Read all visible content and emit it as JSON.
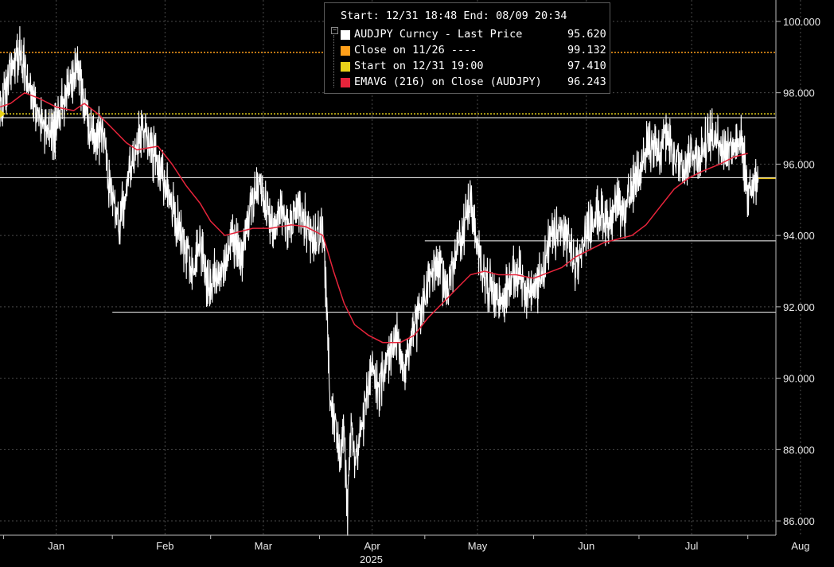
{
  "chart_data": {
    "type": "line",
    "series": [
      {
        "name": "AUDJPY Curncy - Last Price",
        "color": "#ffffff",
        "points": [
          [
            "2024-12-31",
            97.41
          ],
          [
            "2025-01-03",
            98.6
          ],
          [
            "2025-01-06",
            99.1
          ],
          [
            "2025-01-08",
            98.2
          ],
          [
            "2025-01-10",
            97.6
          ],
          [
            "2025-01-13",
            97.1
          ],
          [
            "2025-01-15",
            96.7
          ],
          [
            "2025-01-17",
            97.5
          ],
          [
            "2025-01-20",
            98.3
          ],
          [
            "2025-01-22",
            98.7
          ],
          [
            "2025-01-24",
            97.6
          ],
          [
            "2025-01-27",
            96.6
          ],
          [
            "2025-01-29",
            97.0
          ],
          [
            "2025-01-31",
            95.6
          ],
          [
            "2025-02-03",
            94.4
          ],
          [
            "2025-02-05",
            95.3
          ],
          [
            "2025-02-07",
            96.2
          ],
          [
            "2025-02-10",
            97.1
          ],
          [
            "2025-02-12",
            96.5
          ],
          [
            "2025-02-14",
            95.9
          ],
          [
            "2025-02-17",
            95.2
          ],
          [
            "2025-02-19",
            94.5
          ],
          [
            "2025-02-21",
            93.9
          ],
          [
            "2025-02-24",
            93.0
          ],
          [
            "2025-02-26",
            93.9
          ],
          [
            "2025-02-28",
            92.5
          ],
          [
            "2025-03-03",
            92.9
          ],
          [
            "2025-03-05",
            93.2
          ],
          [
            "2025-03-07",
            94.0
          ],
          [
            "2025-03-10",
            93.4
          ],
          [
            "2025-03-12",
            94.5
          ],
          [
            "2025-03-14",
            95.5
          ],
          [
            "2025-03-17",
            94.9
          ],
          [
            "2025-03-19",
            94.1
          ],
          [
            "2025-03-21",
            94.7
          ],
          [
            "2025-03-24",
            94.3
          ],
          [
            "2025-03-26",
            95.0
          ],
          [
            "2025-03-28",
            94.4
          ],
          [
            "2025-03-31",
            93.7
          ],
          [
            "2025-04-02",
            94.4
          ],
          [
            "2025-04-03",
            92.2
          ],
          [
            "2025-04-04",
            89.6
          ],
          [
            "2025-04-07",
            87.7
          ],
          [
            "2025-04-08",
            88.6
          ],
          [
            "2025-04-09",
            86.2
          ],
          [
            "2025-04-10",
            88.9
          ],
          [
            "2025-04-11",
            87.4
          ],
          [
            "2025-04-14",
            89.2
          ],
          [
            "2025-04-16",
            90.4
          ],
          [
            "2025-04-18",
            89.8
          ],
          [
            "2025-04-21",
            90.6
          ],
          [
            "2025-04-23",
            91.1
          ],
          [
            "2025-04-25",
            90.3
          ],
          [
            "2025-04-28",
            91.4
          ],
          [
            "2025-04-30",
            91.9
          ],
          [
            "2025-05-02",
            92.8
          ],
          [
            "2025-05-05",
            93.3
          ],
          [
            "2025-05-07",
            92.5
          ],
          [
            "2025-05-09",
            93.1
          ],
          [
            "2025-05-12",
            94.2
          ],
          [
            "2025-05-14",
            95.1
          ],
          [
            "2025-05-16",
            93.5
          ],
          [
            "2025-05-19",
            92.6
          ],
          [
            "2025-05-21",
            92.4
          ],
          [
            "2025-05-23",
            92.1
          ],
          [
            "2025-05-26",
            92.8
          ],
          [
            "2025-05-28",
            93.0
          ],
          [
            "2025-05-30",
            92.3
          ],
          [
            "2025-06-02",
            92.6
          ],
          [
            "2025-06-04",
            93.2
          ],
          [
            "2025-06-06",
            93.9
          ],
          [
            "2025-06-09",
            94.2
          ],
          [
            "2025-06-11",
            93.8
          ],
          [
            "2025-06-13",
            93.1
          ],
          [
            "2025-06-16",
            94.1
          ],
          [
            "2025-06-18",
            94.4
          ],
          [
            "2025-06-20",
            94.7
          ],
          [
            "2025-06-23",
            94.3
          ],
          [
            "2025-06-25",
            94.9
          ],
          [
            "2025-06-27",
            94.6
          ],
          [
            "2025-06-30",
            95.6
          ],
          [
            "2025-07-02",
            96.1
          ],
          [
            "2025-07-04",
            96.6
          ],
          [
            "2025-07-07",
            96.2
          ],
          [
            "2025-07-09",
            96.9
          ],
          [
            "2025-07-11",
            96.3
          ],
          [
            "2025-07-14",
            96.0
          ],
          [
            "2025-07-16",
            96.4
          ],
          [
            "2025-07-18",
            96.2
          ],
          [
            "2025-07-21",
            96.7
          ],
          [
            "2025-07-23",
            96.9
          ],
          [
            "2025-07-25",
            96.4
          ],
          [
            "2025-07-28",
            96.6
          ],
          [
            "2025-07-30",
            96.8
          ],
          [
            "2025-07-31",
            96.0
          ],
          [
            "2025-08-01",
            95.3
          ],
          [
            "2025-08-04",
            95.6
          ]
        ]
      },
      {
        "name": "EMAVG (216)  on Close (AUDJPY)",
        "color": "#e8243b",
        "points": [
          [
            "2024-12-31",
            97.6
          ],
          [
            "2025-01-03",
            97.7
          ],
          [
            "2025-01-07",
            98.0
          ],
          [
            "2025-01-11",
            97.85
          ],
          [
            "2025-01-16",
            97.6
          ],
          [
            "2025-01-21",
            97.5
          ],
          [
            "2025-01-24",
            97.7
          ],
          [
            "2025-01-28",
            97.4
          ],
          [
            "2025-02-01",
            97.0
          ],
          [
            "2025-02-05",
            96.6
          ],
          [
            "2025-02-08",
            96.4
          ],
          [
            "2025-02-14",
            96.5
          ],
          [
            "2025-02-18",
            96.0
          ],
          [
            "2025-02-22",
            95.4
          ],
          [
            "2025-02-26",
            94.9
          ],
          [
            "2025-03-01",
            94.4
          ],
          [
            "2025-03-05",
            94.0
          ],
          [
            "2025-03-09",
            94.1
          ],
          [
            "2025-03-13",
            94.2
          ],
          [
            "2025-03-18",
            94.2
          ],
          [
            "2025-03-24",
            94.3
          ],
          [
            "2025-03-28",
            94.25
          ],
          [
            "2025-04-02",
            94.0
          ],
          [
            "2025-04-05",
            93.0
          ],
          [
            "2025-04-08",
            92.1
          ],
          [
            "2025-04-11",
            91.5
          ],
          [
            "2025-04-15",
            91.2
          ],
          [
            "2025-04-19",
            91.0
          ],
          [
            "2025-04-24",
            91.0
          ],
          [
            "2025-04-28",
            91.2
          ],
          [
            "2025-05-02",
            91.7
          ],
          [
            "2025-05-06",
            92.1
          ],
          [
            "2025-05-10",
            92.5
          ],
          [
            "2025-05-14",
            92.9
          ],
          [
            "2025-05-18",
            93.0
          ],
          [
            "2025-05-22",
            92.9
          ],
          [
            "2025-05-27",
            92.9
          ],
          [
            "2025-06-01",
            92.8
          ],
          [
            "2025-06-05",
            92.95
          ],
          [
            "2025-06-09",
            93.1
          ],
          [
            "2025-06-13",
            93.4
          ],
          [
            "2025-06-17",
            93.6
          ],
          [
            "2025-06-21",
            93.8
          ],
          [
            "2025-06-25",
            93.9
          ],
          [
            "2025-06-29",
            94.0
          ],
          [
            "2025-07-03",
            94.3
          ],
          [
            "2025-07-07",
            94.8
          ],
          [
            "2025-07-11",
            95.3
          ],
          [
            "2025-07-15",
            95.6
          ],
          [
            "2025-07-19",
            95.8
          ],
          [
            "2025-07-24",
            96.0
          ],
          [
            "2025-07-28",
            96.2
          ],
          [
            "2025-08-01",
            96.3
          ]
        ]
      }
    ],
    "reference_lines": [
      {
        "y": 99.132,
        "color": "#ff9f1a",
        "style": "dotted",
        "span": "full"
      },
      {
        "y": 97.41,
        "color": "#e8d21a",
        "style": "dotted",
        "span": "full"
      },
      {
        "y": 97.3,
        "color": "#ffffff",
        "style": "solid",
        "span": "full"
      },
      {
        "y": 95.62,
        "color": "#ffffff",
        "style": "solid",
        "span": "full"
      },
      {
        "y": 93.85,
        "color": "#ffffff",
        "style": "solid",
        "from": "2025-05-01"
      },
      {
        "y": 91.85,
        "color": "#ffffff",
        "style": "solid",
        "from": "2025-02-01"
      }
    ],
    "ylim": [
      85.6,
      100.6
    ],
    "y_ticks": [
      "86.000",
      "88.000",
      "90.000",
      "92.000",
      "94.000",
      "96.000",
      "98.000",
      "100.000"
    ],
    "x_range": [
      "2024-12-31",
      "2025-08-09"
    ],
    "x_ticks": [
      {
        "label": "Jan",
        "date": "2025-01-01"
      },
      {
        "label": "Feb",
        "date": "2025-02-01"
      },
      {
        "label": "Mar",
        "date": "2025-03-01"
      },
      {
        "label": "Apr",
        "date": "2025-04-01"
      },
      {
        "label": "May",
        "date": "2025-05-01"
      },
      {
        "label": "Jun",
        "date": "2025-06-01"
      },
      {
        "label": "Jul",
        "date": "2025-07-01"
      },
      {
        "label": "Aug",
        "date": "2025-08-01"
      }
    ],
    "year_label": "2025",
    "grid": true,
    "legend_placement": "top-center"
  },
  "legend": {
    "header": "Start: 12/31 18:48 End: 08/09 20:34",
    "items": [
      {
        "name": "AUDJPY Curncy - Last Price",
        "value": "95.620",
        "color": "#ffffff"
      },
      {
        "name": "Close on 11/26 ----",
        "value": "99.132",
        "color": "#ff9f1a"
      },
      {
        "name": "Start on 12/31 19:00",
        "value": "97.410",
        "color": "#e8d21a"
      },
      {
        "name": "EMAVG (216)  on Close (AUDJPY)",
        "value": "96.243",
        "color": "#e8243b"
      }
    ]
  }
}
